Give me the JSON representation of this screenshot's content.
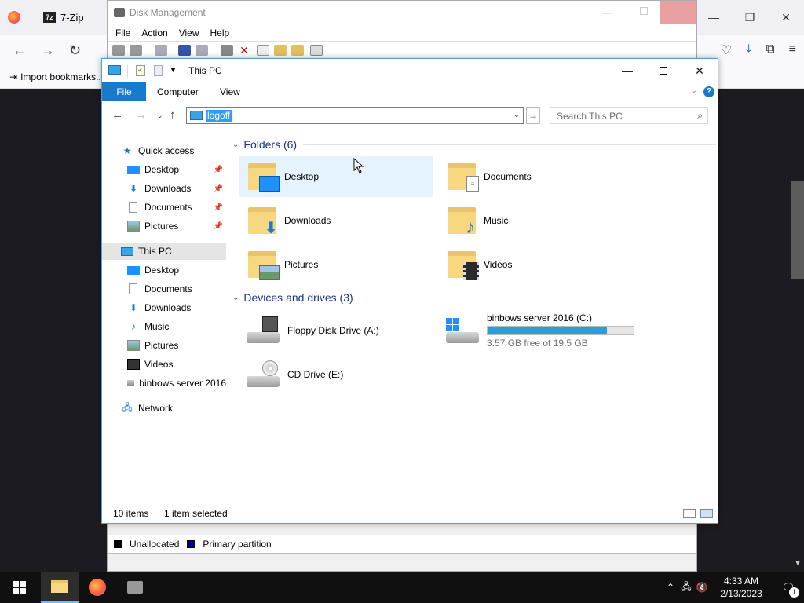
{
  "firefox": {
    "tab_7zip": "7-Zip",
    "bookmark_import": "Import bookmarks..."
  },
  "disk_management": {
    "title": "Disk Management",
    "menu": [
      "File",
      "Action",
      "View",
      "Help"
    ],
    "legend": {
      "unallocated": "Unallocated",
      "primary": "Primary partition"
    },
    "colors": {
      "unallocated": "#000000",
      "primary": "#000080"
    }
  },
  "explorer": {
    "title": "This PC",
    "ribbon_tabs": {
      "file": "File",
      "computer": "Computer",
      "view": "View"
    },
    "address_value": "logoff",
    "search_placeholder": "Search This PC",
    "nav": {
      "quick_access": "Quick access",
      "qa_items": [
        "Desktop",
        "Downloads",
        "Documents",
        "Pictures"
      ],
      "this_pc": "This PC",
      "pc_items": [
        "Desktop",
        "Documents",
        "Downloads",
        "Music",
        "Pictures",
        "Videos",
        "binbows server 2016"
      ],
      "network": "Network"
    },
    "folders_header": "Folders (6)",
    "folders": [
      "Desktop",
      "Documents",
      "Downloads",
      "Music",
      "Pictures",
      "Videos"
    ],
    "devices_header": "Devices and drives (3)",
    "drives": {
      "floppy": "Floppy Disk Drive (A:)",
      "cdrom": "CD Drive (E:)",
      "system": {
        "name": "binbows server 2016 (C:)",
        "free_text": "3.57 GB free of 19.5 GB",
        "used_fraction": 0.817
      }
    },
    "status": {
      "count": "10 items",
      "selected": "1 item selected"
    },
    "accent": "#1979ca"
  },
  "taskbar": {
    "time": "4:33 AM",
    "date": "2/13/2023",
    "notif_count": "1"
  }
}
